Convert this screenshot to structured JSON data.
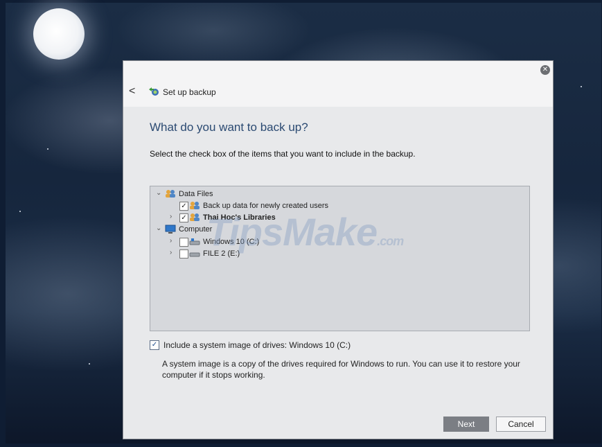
{
  "dialog": {
    "back_glyph": "<",
    "close_glyph": "✕",
    "title": "Set up backup",
    "heading": "What do you want to back up?",
    "instruction": "Select the check box of the items that you want to include in the backup."
  },
  "tree": {
    "items": [
      {
        "label": "Data Files",
        "icon": "users-icon",
        "expander": "expanded",
        "checked": null,
        "bold": false
      },
      {
        "label": "Back up data for newly created users",
        "icon": "users-icon",
        "expander": "none",
        "checked": true,
        "bold": false
      },
      {
        "label": "Thai Hoc's Libraries",
        "icon": "users-icon",
        "expander": "collapsed",
        "checked": true,
        "bold": true
      },
      {
        "label": "Computer",
        "icon": "computer-icon",
        "expander": "expanded",
        "checked": null,
        "bold": false
      },
      {
        "label": "Windows 10 (C:)",
        "icon": "drive-icon",
        "expander": "collapsed",
        "checked": false,
        "bold": false
      },
      {
        "label": "FILE 2 (E:)",
        "icon": "drive-icon",
        "expander": "collapsed",
        "checked": false,
        "bold": false
      }
    ]
  },
  "system_image": {
    "checked": true,
    "label": "Include a system image of drives: Windows 10 (C:)",
    "description": "A system image is a copy of the drives required for Windows to run. You can use it to restore your computer if it stops working."
  },
  "buttons": {
    "next": "Next",
    "cancel": "Cancel"
  },
  "watermark": {
    "text": "TipsMake",
    "suffix": ".com"
  },
  "colors": {
    "heading": "#2b4a72",
    "dialog_bg": "#e8e9eb",
    "tree_bg": "#d6d8dc",
    "next_button": "#7b7e84"
  }
}
